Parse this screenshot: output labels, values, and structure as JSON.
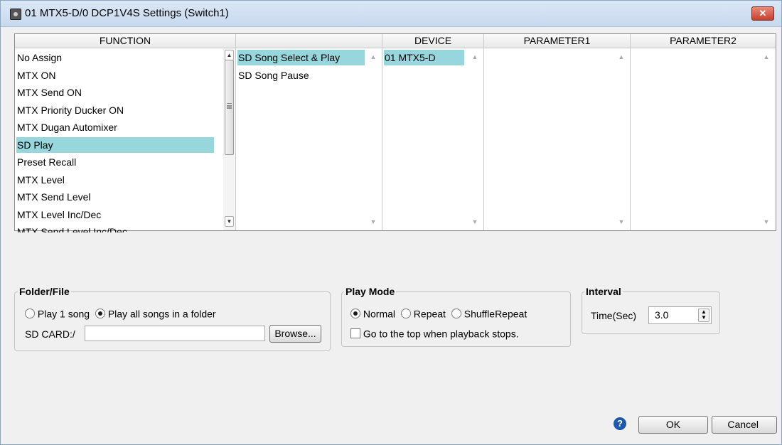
{
  "window": {
    "title": "01 MTX5-D/0 DCP1V4S Settings (Switch1)",
    "close_symbol": "✕"
  },
  "columns": {
    "function": "FUNCTION",
    "sub": "",
    "device": "DEVICE",
    "param1": "PARAMETER1",
    "param2": "PARAMETER2"
  },
  "function_list": [
    "No Assign",
    "MTX ON",
    "MTX Send ON",
    "MTX Priority Ducker ON",
    "MTX Dugan Automixer",
    "SD Play",
    "Preset Recall",
    "MTX Level",
    "MTX Send Level",
    "MTX Level Inc/Dec",
    "MTX Send Level Inc/Dec"
  ],
  "function_selected": "SD Play",
  "sub_list": [
    "SD Song Select & Play",
    "SD Song Pause"
  ],
  "sub_selected": "SD Song Select & Play",
  "device_list": [
    "01 MTX5-D"
  ],
  "device_selected": "01 MTX5-D",
  "folder_file": {
    "legend": "Folder/File",
    "radio1": "Play 1 song",
    "radio2": "Play all songs in a folder",
    "selected": "Play all songs in a folder",
    "path_label": "SD CARD:/",
    "path_value": "",
    "browse_label": "Browse..."
  },
  "play_mode": {
    "legend": "Play Mode",
    "normal": "Normal",
    "repeat": "Repeat",
    "shuffle": "ShuffleRepeat",
    "selected": "Normal",
    "checkbox_label": "Go to the top when playback stops.",
    "checkbox_checked": false
  },
  "interval": {
    "legend": "Interval",
    "label": "Time(Sec)",
    "value": "3.0"
  },
  "footer": {
    "help": "?",
    "ok": "OK",
    "cancel": "Cancel"
  }
}
